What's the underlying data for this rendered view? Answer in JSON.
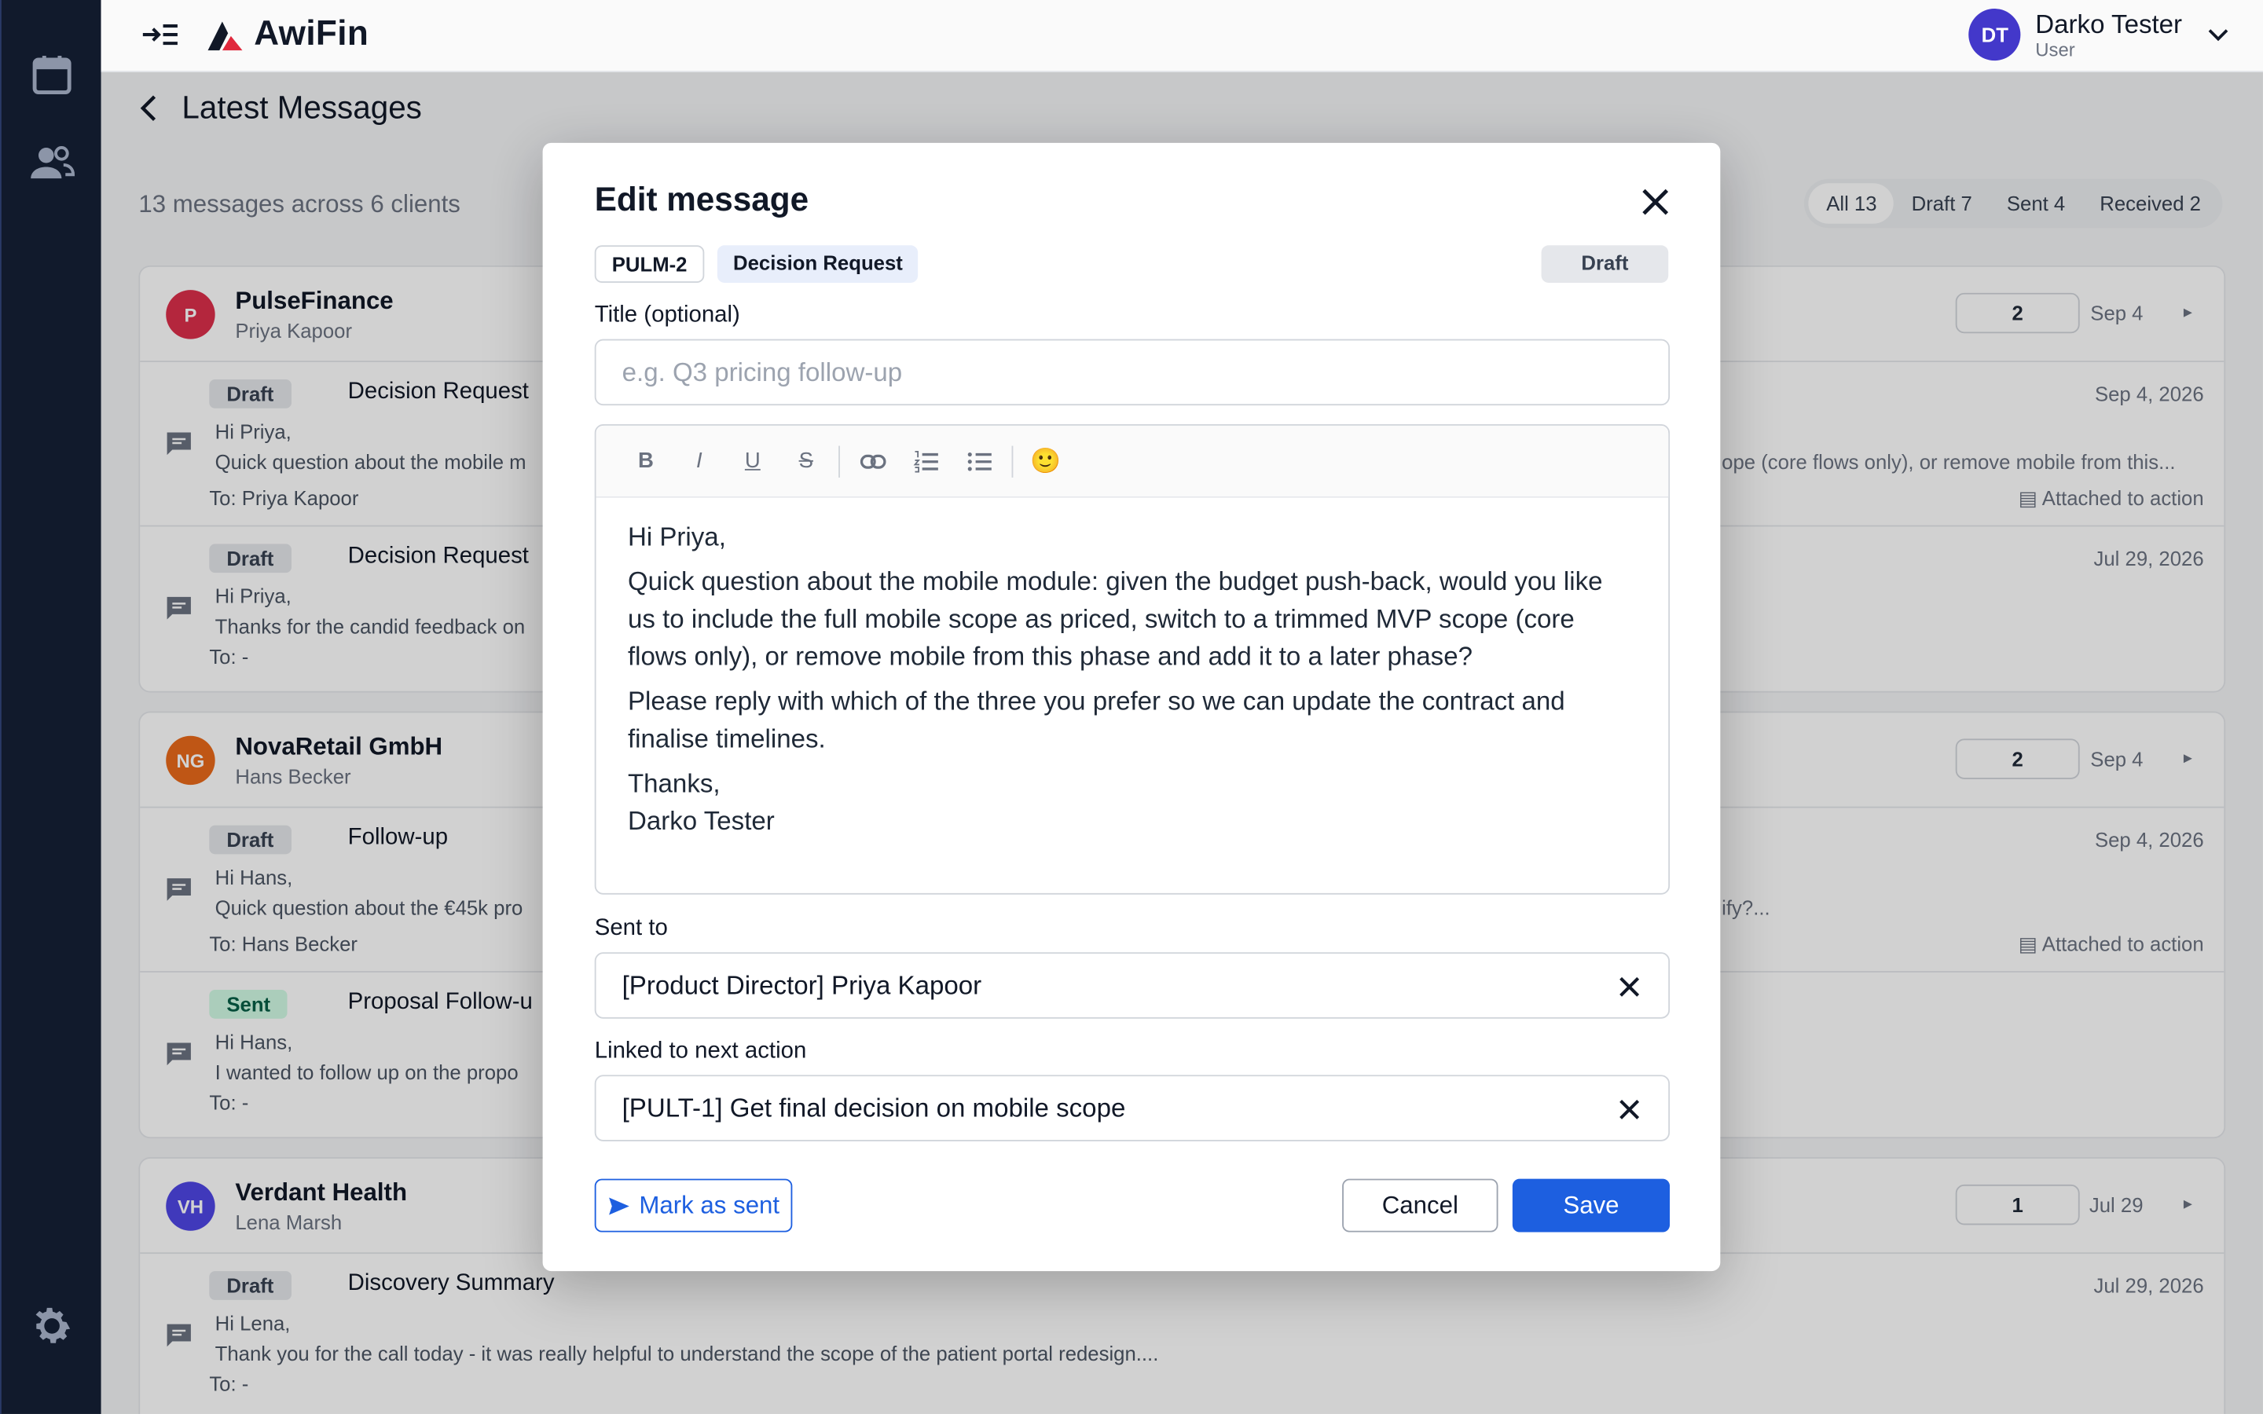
{
  "app": {
    "name": "AwiFin"
  },
  "user": {
    "initials": "DT",
    "name": "Darko Tester",
    "role": "User"
  },
  "page": {
    "title": "Latest Messages",
    "summary": "13 messages across 6 clients"
  },
  "filters": [
    {
      "label": "All 13"
    },
    {
      "label": "Draft 7"
    },
    {
      "label": "Sent 4"
    },
    {
      "label": "Received 2"
    }
  ],
  "clients": [
    {
      "initials": "P",
      "color": "#dc2f4b",
      "name": "PulseFinance",
      "contact": "Priya Kapoor",
      "count": "2",
      "date": "Sep 4",
      "messages": [
        {
          "status": "Draft",
          "title": "Decision Request",
          "date": "Sep 4, 2026",
          "line1": "Hi Priya,",
          "line2": "Quick question about the mobile m",
          "line2_right": "ope (core flows only), or remove mobile from this...",
          "to": "To: Priya Kapoor",
          "attached": "Attached to action"
        },
        {
          "status": "Draft",
          "title": "Decision Request",
          "date": "Jul 29, 2026",
          "line1": "Hi Priya,",
          "line2": "Thanks for the candid feedback on",
          "to": "To: -"
        }
      ]
    },
    {
      "initials": "NG",
      "color": "#ea6a1a",
      "name": "NovaRetail GmbH",
      "contact": "Hans Becker",
      "count": "2",
      "date": "Sep 4",
      "messages": [
        {
          "status": "Draft",
          "title": "Follow-up",
          "date": "Sep 4, 2026",
          "line1": "Hi Hans,",
          "line2": "Quick question about the €45k pro",
          "line2_right": "ify?...",
          "to": "To: Hans Becker",
          "attached": "Attached to action"
        },
        {
          "status": "Sent",
          "title": "Proposal Follow-u",
          "date": "",
          "line1": "Hi Hans,",
          "line2": "I wanted to follow up on the propo",
          "to": "To: -"
        }
      ]
    },
    {
      "initials": "VH",
      "color": "#4f46e5",
      "name": "Verdant Health",
      "contact": "Lena Marsh",
      "count": "1",
      "date": "Jul 29",
      "messages": [
        {
          "status": "Draft",
          "title": "Discovery Summary",
          "date": "Jul 29, 2026",
          "line1": "Hi Lena,",
          "line2": "Thank you for the call today - it was really helpful to understand the scope of the patient portal redesign....",
          "to": "To: -"
        }
      ]
    }
  ],
  "modal": {
    "title": "Edit message",
    "id_chip": "PULM-2",
    "type_chip": "Decision Request",
    "status_chip": "Draft",
    "title_label": "Title (optional)",
    "title_placeholder": "e.g. Q3 pricing follow-up",
    "body": [
      "Hi Priya,",
      "Quick question about the mobile module: given the budget push-back, would you like us to include the full mobile scope as priced, switch to a trimmed MVP scope (core flows only), or remove mobile from this phase and add it to a later phase?",
      "Please reply with which of the three you prefer so we can update the contract and finalise timelines.",
      "Thanks,"
    ],
    "signature": "Darko Tester",
    "toolbar": {
      "bold": "B",
      "italic": "I",
      "underline": "U",
      "strike": "S",
      "emoji": "🙂"
    },
    "sent_to_label": "Sent to",
    "sent_to_value": "[Product Director] Priya Kapoor",
    "linked_label": "Linked to next action",
    "linked_value": "[PULT-1] Get final decision on mobile scope",
    "mark_sent": "Mark as sent",
    "cancel": "Cancel",
    "save": "Save"
  },
  "colors": {
    "primary": "#1d5fe0",
    "sidebar": "#111a2c"
  }
}
